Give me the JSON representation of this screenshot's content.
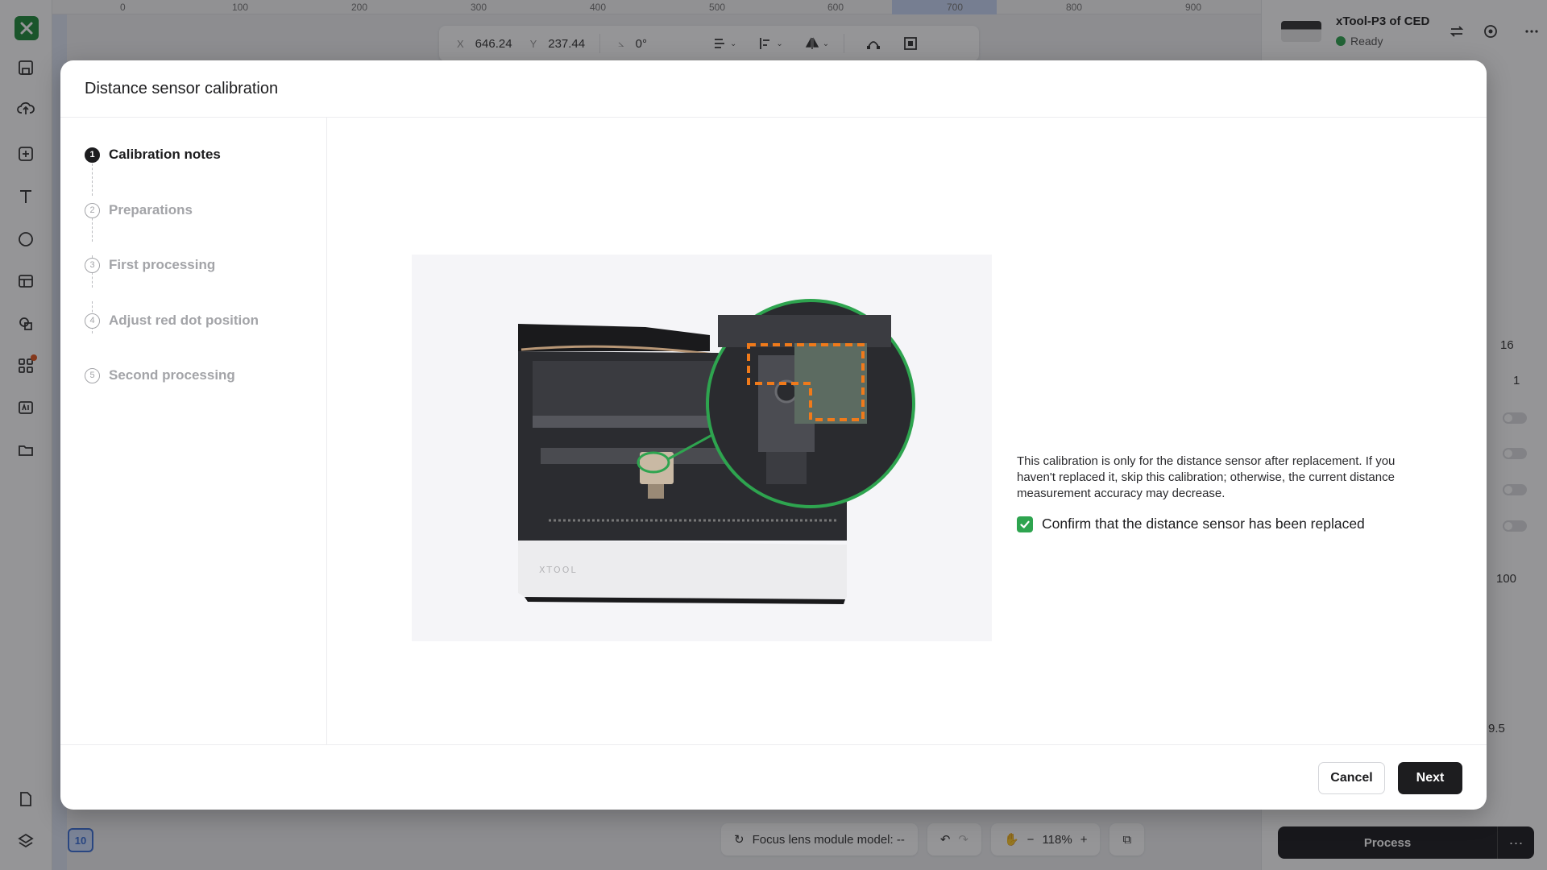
{
  "background": {
    "ruler_ticks": [
      "0",
      "100",
      "200",
      "300",
      "400",
      "500",
      "600",
      "700",
      "800",
      "900"
    ],
    "coords": {
      "x_label": "X",
      "x_value": "646.24",
      "y_label": "Y",
      "y_value": "237.44",
      "angle_value": "0°"
    },
    "device": {
      "name": "xTool-P3 of CED",
      "status": "Ready"
    },
    "right_values": {
      "v1": "16",
      "v2": "1",
      "v3": "100",
      "v4": "9.5"
    },
    "process": {
      "label": "Process",
      "more": "···"
    },
    "bottom": {
      "focus_label": "Focus lens module model: --",
      "zoom": "118%"
    },
    "layer_chip": "10"
  },
  "dialog": {
    "title": "Distance sensor calibration",
    "steps": [
      {
        "num": "1",
        "label": "Calibration notes",
        "active": true
      },
      {
        "num": "2",
        "label": "Preparations"
      },
      {
        "num": "3",
        "label": "First processing"
      },
      {
        "num": "4",
        "label": "Adjust red dot position"
      },
      {
        "num": "5",
        "label": "Second processing"
      }
    ],
    "description": "This calibration is only for the distance sensor after replacement. If you haven't replaced it, skip this calibration; otherwise, the current distance measurement accuracy may decrease.",
    "confirm_label": "Confirm that the distance sensor has been replaced",
    "confirm_checked": true,
    "illustration_brand": "XTOOL",
    "buttons": {
      "cancel": "Cancel",
      "next": "Next"
    }
  },
  "colors": {
    "accent_green": "#2ea44f",
    "primary_dark": "#1d1d1f",
    "callout_orange": "#f07a1a"
  }
}
